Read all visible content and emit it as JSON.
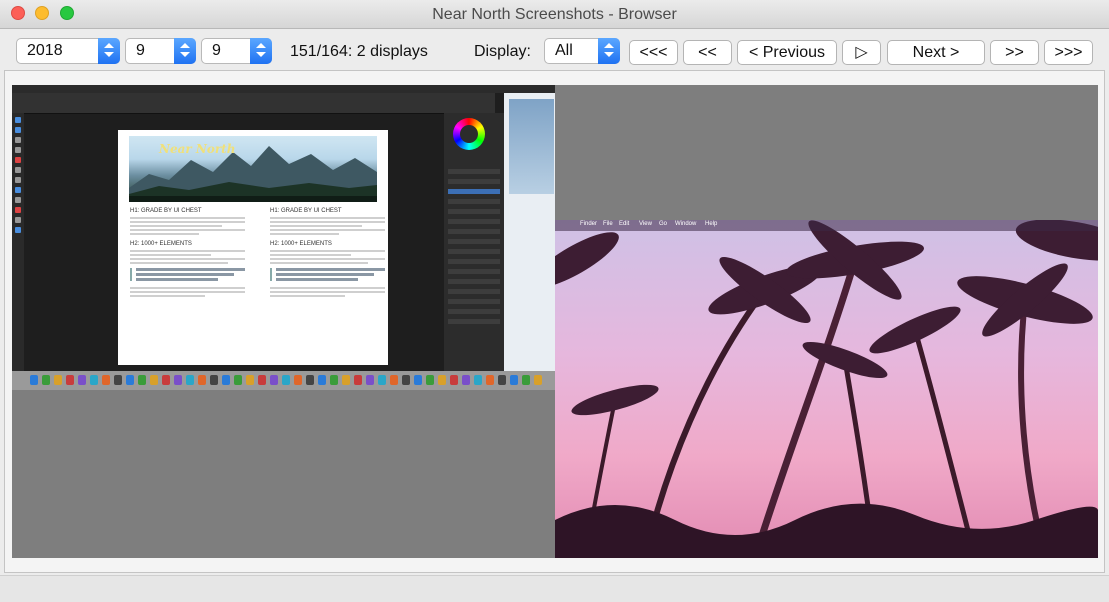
{
  "window": {
    "title": "Near North Screenshots - Browser"
  },
  "toolbar": {
    "year": "2018",
    "month": "9",
    "day": "9",
    "status": "151/164: 2 displays",
    "display_label": "Display:",
    "display_value": "All",
    "buttons": {
      "first": "<<<",
      "back_more": "<<",
      "previous": "< Previous",
      "play": "▷",
      "next": "Next >",
      "forward_more": ">>",
      "last": ">>>"
    }
  },
  "screenshot": {
    "display1": {
      "doc_brand": "Near North",
      "doc_heading_1": "H1: GRADE BY UI CHEST",
      "doc_heading_2": "H2: 1000+ ELEMENTS"
    },
    "display2": {
      "menu_items": [
        "Finder",
        "File",
        "Edit",
        "View",
        "Go",
        "Window",
        "Help"
      ]
    }
  },
  "colors": {
    "accent": "#1f72f2",
    "canvas": "#7e7e7e"
  }
}
